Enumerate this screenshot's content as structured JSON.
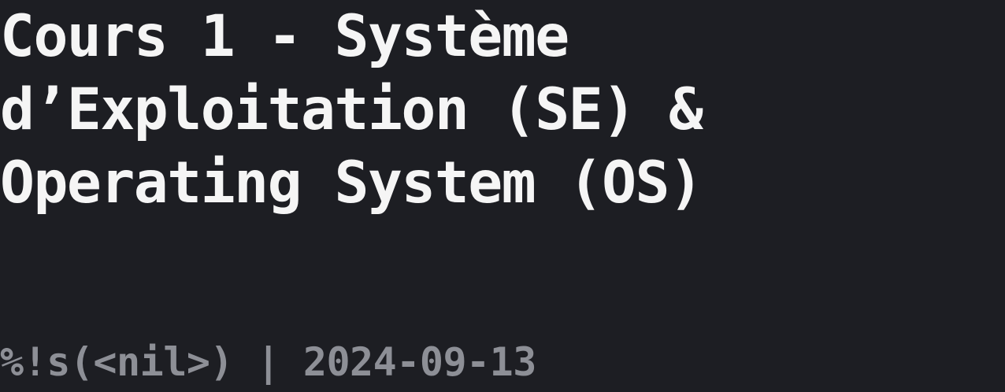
{
  "post": {
    "title_lines": [
      "Cours 1 - Système",
      "d’Exploitation (SE) &",
      "Operating System (OS)"
    ],
    "author": "%!s(<nil>)",
    "separator": " | ",
    "date": "2024-09-13"
  },
  "colors": {
    "background": "#1d1e23",
    "title": "#f5f5f5",
    "meta": "#8d8f96"
  }
}
